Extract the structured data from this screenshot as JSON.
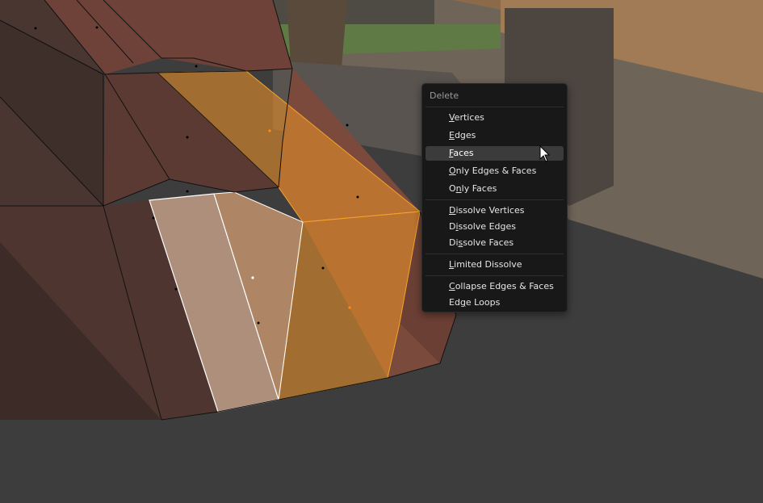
{
  "viewport": {
    "background_color": "#3d3d3d",
    "mesh_face_color": "#7a4a3c",
    "selected_face_color": "#e08a2a",
    "active_face_color": "#d9c4a8",
    "background_image": "photo of wooden log and dirt ground"
  },
  "context_menu": {
    "title": "Delete",
    "items": [
      {
        "label": "Vertices",
        "mnemonic": "V"
      },
      {
        "label": "Edges",
        "mnemonic": "E"
      },
      {
        "label": "Faces",
        "mnemonic": "F",
        "hover": true
      },
      {
        "label": "Only Edges & Faces",
        "mnemonic": "O"
      },
      {
        "label": "Only Faces",
        "mnemonic": "n"
      },
      {
        "label": "Dissolve Vertices",
        "mnemonic": "D"
      },
      {
        "label": "Dissolve Edges",
        "mnemonic": "i"
      },
      {
        "label": "Dissolve Faces",
        "mnemonic": "s"
      },
      {
        "label": "Limited Dissolve",
        "mnemonic": "L"
      },
      {
        "label": "Collapse Edges & Faces",
        "mnemonic": "C"
      },
      {
        "label": "Edge Loops",
        "mnemonic": "g"
      }
    ]
  },
  "cursor_icon": "arrow-pointer-icon"
}
